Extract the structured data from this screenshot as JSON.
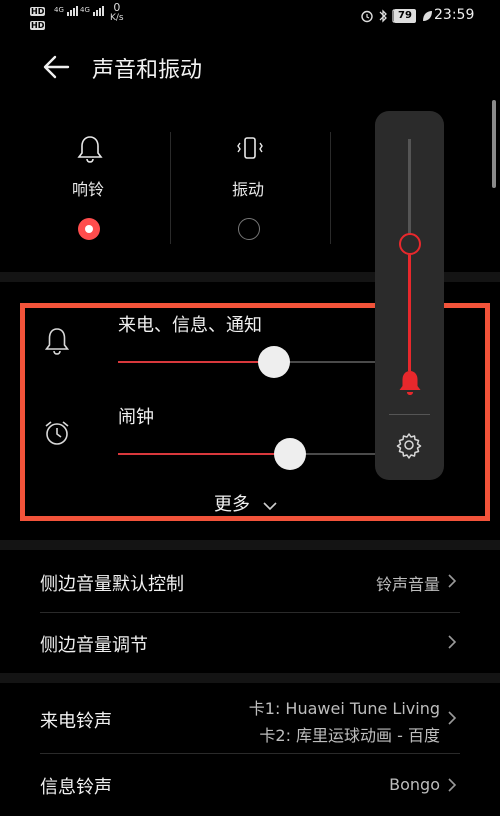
{
  "status_bar": {
    "hd1": "HD",
    "hd2": "HD",
    "net1": "4G",
    "net2": "4G",
    "speed_value": "0",
    "speed_unit": "K/s",
    "battery": "79",
    "time": "23:59"
  },
  "header": {
    "title": "声音和振动"
  },
  "modes": [
    {
      "label": "响铃",
      "selected": true
    },
    {
      "label": "振动",
      "selected": false
    }
  ],
  "volume": {
    "sliders": [
      {
        "label": "来电、信息、通知",
        "level": 0.6
      },
      {
        "label": "闹钟",
        "level": 0.66
      }
    ],
    "more_label": "更多",
    "side_panel_level": 0.5
  },
  "settings": [
    {
      "label": "侧边音量默认控制",
      "value": "铃声音量"
    },
    {
      "label": "侧边音量调节",
      "value": ""
    },
    {
      "label": "来电铃声",
      "value_line1": "卡1: Huawei Tune Living",
      "value_line2": "卡2: 库里运球动画 - 百度"
    },
    {
      "label": "信息铃声",
      "value": "Bongo"
    }
  ],
  "colors": {
    "accent": "#e8282c",
    "highlight_box": "#f2533a",
    "background": "#000000"
  }
}
